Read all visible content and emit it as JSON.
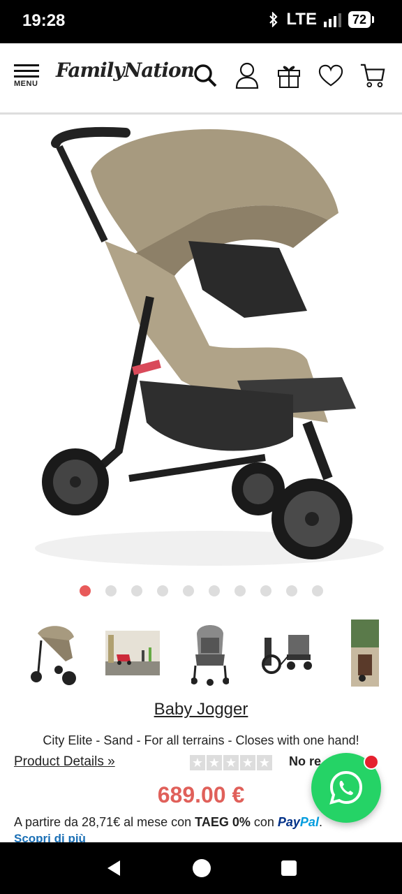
{
  "status": {
    "time": "19:28",
    "network": "LTE",
    "battery": "72"
  },
  "header": {
    "menu_label": "MENU",
    "logo_text": "FamilyNation"
  },
  "gallery": {
    "dot_count": 10,
    "active_index": 0
  },
  "product": {
    "brand": "Baby Jogger",
    "description": "City Elite - Sand - For all terrains - Closes with one hand!",
    "details_link": "Product Details »",
    "rating": 0,
    "reviews_text": "No re",
    "price": "689.00 €"
  },
  "payment": {
    "prefix": "A partire da 28,71€ al mese con ",
    "taeg": "TAEG 0%",
    "with": " con ",
    "paypal_pay": "Pay",
    "paypal_pal": "Pal",
    "suffix": ".",
    "learn_more": "Scopri di più"
  },
  "colors": {
    "price": "#e0605a",
    "accent_dot": "#e85a5a",
    "whatsapp": "#25d366",
    "link": "#1a6fb5"
  }
}
